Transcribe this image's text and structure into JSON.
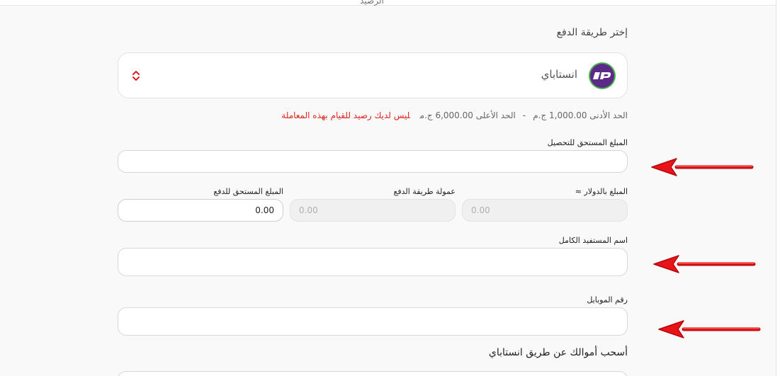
{
  "header": {
    "cut_title": "الرصيد"
  },
  "payment_method": {
    "label": "إختر طريقة الدفع",
    "selected": "انستاباي",
    "logo_text": "Instapay"
  },
  "limits": {
    "min": "الحد الأدنى 1,000.00 ج.م",
    "separator": "-",
    "max": "الحد الأعلى 6,000.00 ج.م",
    "error": "ليس لديك رصيد للقيام بهذه المعاملة"
  },
  "fields": {
    "amount_due_collect": {
      "label": "المبلغ المستحق للتحصيل",
      "value": ""
    },
    "usd_amount": {
      "label": "المبلغ بالدولار ≈",
      "value": "0.00"
    },
    "commission": {
      "label": "عمولة طريقة الدفع",
      "value": "0.00"
    },
    "amount_due_pay": {
      "label": "المبلغ المستحق للدفع",
      "value": "0.00"
    },
    "beneficiary_name": {
      "label": "اسم المستفيد الكامل",
      "value": ""
    },
    "mobile": {
      "label": "رقم الموبايل",
      "value": ""
    }
  },
  "withdraw_section": {
    "label": "أسحب أموالك عن طريق انستاباي"
  },
  "colors": {
    "error": "#e0241f",
    "arrow": "#e8141a",
    "logo_bg": "#5b2a86",
    "logo_ring": "#4caf50"
  }
}
